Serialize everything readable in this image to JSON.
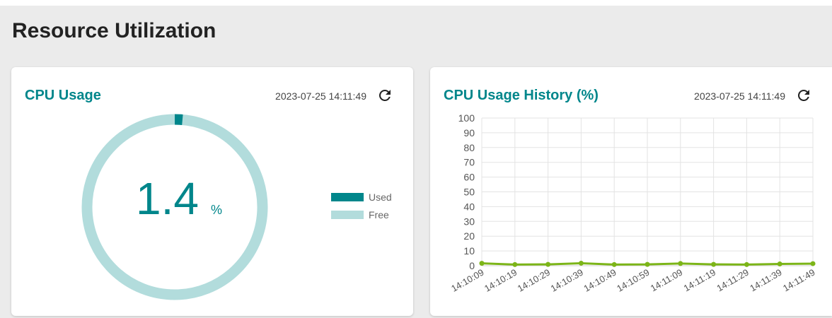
{
  "page": {
    "title": "Resource Utilization"
  },
  "cpu_usage": {
    "title": "CPU Usage",
    "timestamp": "2023-07-25 14:11:49",
    "refresh_icon": "refresh-icon",
    "value": "1.4",
    "unit": "%",
    "used_percent": 1.4,
    "legend": {
      "used": "Used",
      "free": "Free"
    },
    "colors": {
      "used": "#00868b",
      "free": "#b2dcdc",
      "accent": "#00868b"
    }
  },
  "cpu_history": {
    "title": "CPU Usage History (%)",
    "timestamp": "2023-07-25 14:11:49",
    "refresh_icon": "refresh-icon"
  },
  "chart_data": {
    "type": "line",
    "x": [
      "14:10:09",
      "14:10:19",
      "14:10:29",
      "14:10:39",
      "14:10:49",
      "14:10:59",
      "14:11:09",
      "14:11:19",
      "14:11:29",
      "14:11:39",
      "14:11:49"
    ],
    "series": [
      {
        "values": [
          1.6,
          0.8,
          0.9,
          1.7,
          0.8,
          0.9,
          1.5,
          0.9,
          0.8,
          1.2,
          1.4
        ],
        "color": "#7cb518"
      }
    ],
    "y_ticks": [
      0,
      10,
      20,
      30,
      40,
      50,
      60,
      70,
      80,
      90,
      100
    ],
    "ylim": [
      0,
      100
    ],
    "grid": true
  }
}
